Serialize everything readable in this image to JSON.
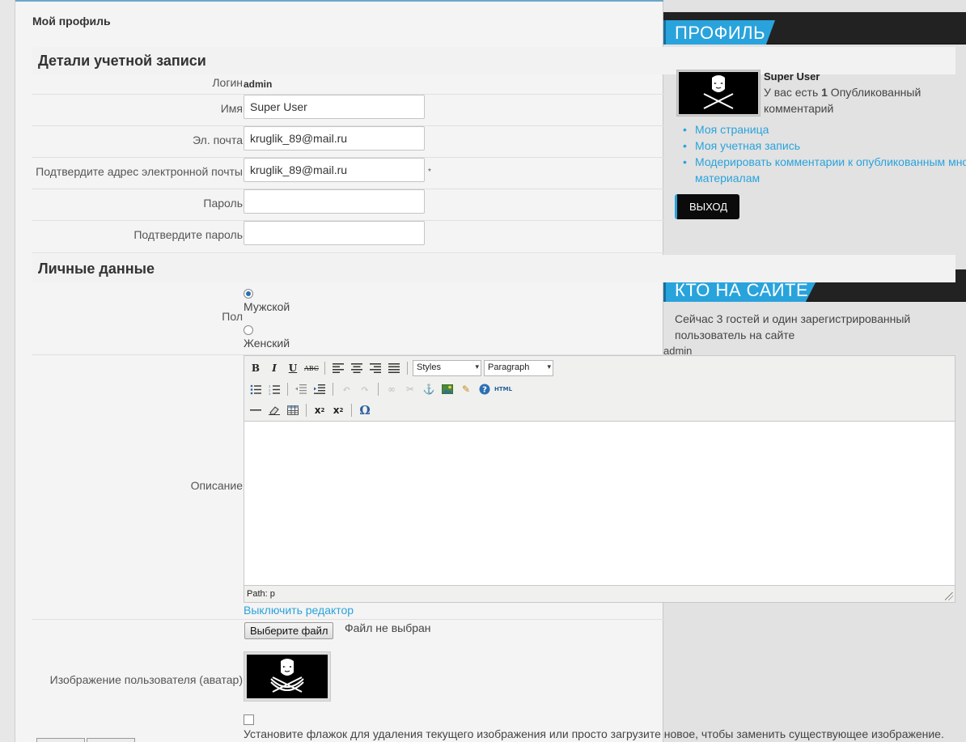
{
  "page": {
    "title": "Мой профиль"
  },
  "account": {
    "heading": "Детали учетной записи",
    "login_label": "Логин",
    "login_value": "admin",
    "name_label": "Имя",
    "name_value": "Super User",
    "email_label": "Эл. почта",
    "email_value": "kruglik_89@mail.ru",
    "email_confirm_label": "Подтвердите адрес электронной почты",
    "email_confirm_value": "kruglik_89@mail.ru",
    "required_mark": "*",
    "password_label": "Пароль",
    "password_value": "",
    "password_confirm_label": "Подтвердите пароль",
    "password_confirm_value": ""
  },
  "personal": {
    "heading": "Личные данные",
    "gender_label": "Пол",
    "gender_options": [
      {
        "label": "Мужской",
        "checked": true
      },
      {
        "label": "Женский",
        "checked": false
      }
    ],
    "description_label": "Описание",
    "editor": {
      "styles_value": "Styles",
      "format_value": "Paragraph",
      "path_text": "Path: p",
      "toggle_link": "Выключить редактор",
      "toolbar_icons": {
        "row1": [
          "bold-icon",
          "italic-icon",
          "underline-icon",
          "strikethrough-icon",
          "align-left-icon",
          "align-center-icon",
          "align-right-icon",
          "align-justify-icon"
        ],
        "row2": [
          "bullet-list-icon",
          "numbered-list-icon",
          "outdent-icon",
          "indent-icon",
          "undo-icon",
          "redo-icon",
          "link-icon",
          "unlink-icon",
          "anchor-icon",
          "image-icon",
          "cleanup-icon",
          "help-icon",
          "html-icon"
        ],
        "row3": [
          "horizontal-rule-icon",
          "eraser-icon",
          "table-icon",
          "subscript-icon",
          "superscript-icon",
          "omega-icon"
        ]
      },
      "html_button_text": "HTML"
    },
    "avatar_label": "Изображение пользователя (аватар)",
    "file_button": "Выберите файл",
    "file_status": "Файл не выбран",
    "delete_avatar_text": "Установите флажок для удаления текущего изображения или просто загрузите новое, чтобы заменить существующее изображение."
  },
  "sidebar": {
    "profile_module_title": "ПРОФИЛЬ",
    "user_name": "Super User",
    "comments_prefix": "У вас есть ",
    "comments_count": "1",
    "comments_suffix": " Опубликованный комментарий",
    "links": [
      "Моя страница",
      "Моя учетная запись",
      "Модерировать комментарии к опубликованным мной материалам"
    ],
    "logout_button": "ВЫХОД",
    "online_module_title": "КТО НА САЙТЕ",
    "online_text": "Сейчас 3 гостей и один зарегистрированный пользователь на сайте",
    "online_user": "admin"
  },
  "colors": {
    "accent": "#29a3dc",
    "header_dark": "#222222"
  }
}
